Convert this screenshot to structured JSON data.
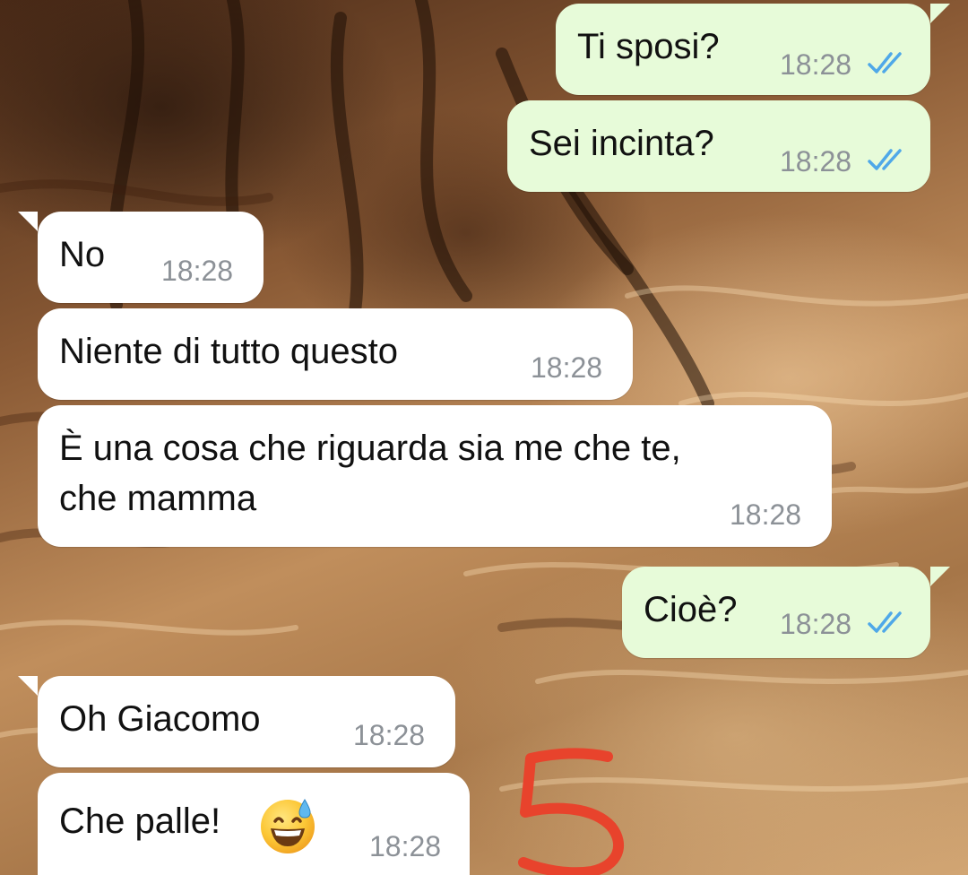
{
  "messages": [
    {
      "id": "m1",
      "direction": "outgoing",
      "text": "Ti sposi?",
      "time": "18:28",
      "status": "read"
    },
    {
      "id": "m2",
      "direction": "outgoing",
      "text": "Sei incinta?",
      "time": "18:28",
      "status": "read"
    },
    {
      "id": "m3",
      "direction": "incoming",
      "text": "No",
      "time": "18:28"
    },
    {
      "id": "m4",
      "direction": "incoming",
      "text": "Niente di tutto questo",
      "time": "18:28"
    },
    {
      "id": "m5",
      "direction": "incoming",
      "text_line1": "È una cosa che riguarda sia me che te,",
      "text_line2": "che mamma",
      "time": "18:28"
    },
    {
      "id": "m6",
      "direction": "outgoing",
      "text": "Cioè?",
      "time": "18:28",
      "status": "read"
    },
    {
      "id": "m7",
      "direction": "incoming",
      "text": "Oh Giacomo",
      "time": "18:28"
    },
    {
      "id": "m8",
      "direction": "incoming",
      "text": "Che palle!",
      "emoji": "grinning-face-with-sweat",
      "time": "18:28"
    }
  ],
  "annotation": {
    "text": "5",
    "color": "#e8432c"
  },
  "colors": {
    "outgoing_bubble": "#e7fbd9",
    "incoming_bubble": "#ffffff",
    "read_tick": "#4fa8e8",
    "timestamp": "#8c9197"
  },
  "icons": {
    "read_receipt": "double-check-icon"
  }
}
